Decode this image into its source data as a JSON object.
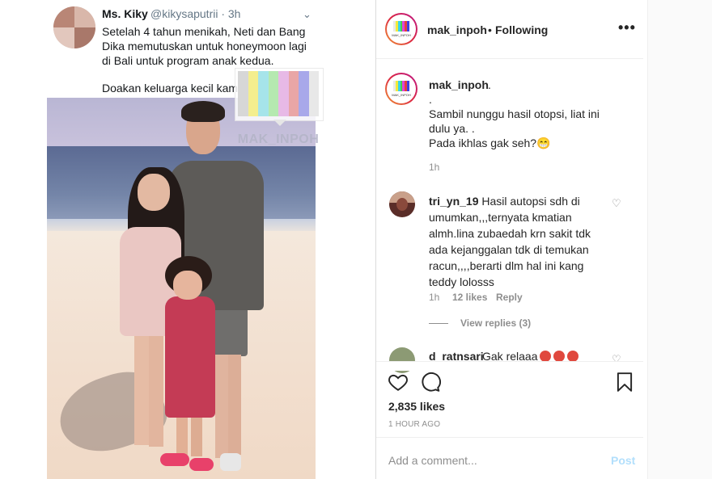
{
  "tweet": {
    "name": "Ms. Kiky",
    "handle": "@kikysaputrii · 3h",
    "lines": [
      "Setelah 4 tahun menikah, Neti dan Bang",
      "Dika memutuskan untuk honeymoon lagi",
      "di Bali untuk program anak kedua.",
      "Doakan keluarga kecil kami luv"
    ],
    "heart": "🖤"
  },
  "watermark": {
    "text": "MAK_INPOH",
    "bar_colors": [
      "#d7d7d7",
      "#f4ee8e",
      "#a6e4ea",
      "#b5e9b0",
      "#e7b9e6",
      "#e9a6a6",
      "#a8a8ea",
      "#e8e8e8"
    ]
  },
  "logo": {
    "caption": "MAK_INPOH",
    "bar_colors": [
      "#e8e8e8",
      "#f2ea3c",
      "#38d5e6",
      "#43d14a",
      "#e043d9",
      "#e43f3f",
      "#3f3fe2"
    ]
  },
  "header": {
    "username": "mak_inpoh",
    "separator": "•",
    "follow_status": "Following",
    "more": "•••"
  },
  "caption": {
    "username": "mak_inpoh",
    "dot": ".",
    "lines": [
      ".",
      "Sambil nunggu hasil otopsi, liat ini",
      "dulu ya. .",
      "Pada ikhlas gak seh?😁"
    ],
    "time": "1h"
  },
  "comment1": {
    "username": "tri_yn_19",
    "lines": [
      "Hasil autopsi sdh di",
      "umumkan,,,ternyata kmatian",
      "almh.lina zubaedah krn sakit tdk",
      "ada kejanggalan tdk di temukan",
      "racun,,,,berarti dlm hal ini kang",
      "teddy lolosss"
    ],
    "time": "1h",
    "likes": "12 likes",
    "reply": "Reply",
    "view_replies": "View replies (3)"
  },
  "comment2": {
    "username": "d_ratnsari",
    "text": "Gak relaaa"
  },
  "post": {
    "likes": "2,835 likes",
    "time": "1 HOUR AGO",
    "add_comment_placeholder": "Add a comment...",
    "post_button": "Post"
  },
  "colors": {
    "text": "#262626",
    "muted": "#8e8e8e",
    "post_button": "#b2dffc",
    "divider": "#dbdbdb"
  }
}
